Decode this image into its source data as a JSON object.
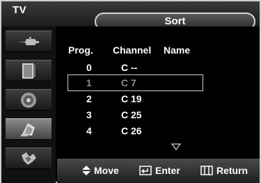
{
  "header": {
    "app_label": "TV",
    "title": "Sort"
  },
  "sidebar": {
    "items": [
      {
        "icon": "antenna-plug-icon",
        "active": false
      },
      {
        "icon": "picture-panel-icon",
        "active": false
      },
      {
        "icon": "speaker-icon",
        "active": false
      },
      {
        "icon": "channel-satellite-icon",
        "active": true
      },
      {
        "icon": "setup-tools-icon",
        "active": false
      }
    ]
  },
  "table": {
    "headers": {
      "prog": "Prog.",
      "channel": "Channel",
      "name": "Name"
    },
    "rows": [
      {
        "prog": "0",
        "channel": "C --",
        "selected": false
      },
      {
        "prog": "1",
        "channel": "C 7",
        "selected": true
      },
      {
        "prog": "2",
        "channel": "C 19",
        "selected": false
      },
      {
        "prog": "3",
        "channel": "C 25",
        "selected": false
      },
      {
        "prog": "4",
        "channel": "C 26",
        "selected": false
      }
    ]
  },
  "footer": {
    "move_label": "Move",
    "enter_label": "Enter",
    "return_label": "Return"
  },
  "colors": {
    "background": "#000000",
    "text": "#ffffff",
    "selected_text": "#8c8c8c"
  }
}
